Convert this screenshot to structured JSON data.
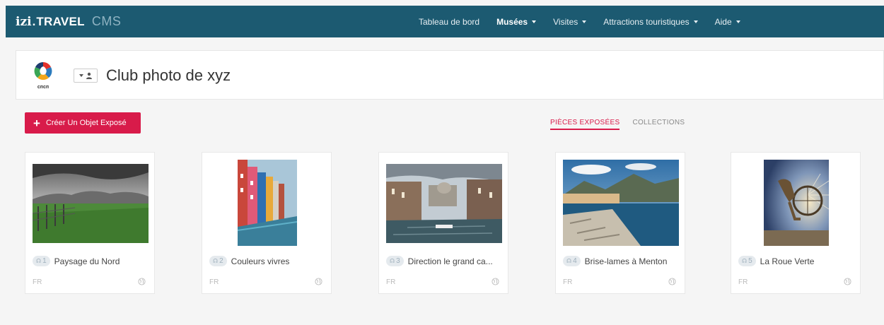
{
  "brand": {
    "izi": "izi",
    "dot": ".",
    "travel": "TRAVEL",
    "cms": "CMS"
  },
  "nav": [
    {
      "label": "Tableau de bord",
      "dropdown": false,
      "active": false
    },
    {
      "label": "Musées",
      "dropdown": true,
      "active": true
    },
    {
      "label": "Visites",
      "dropdown": true,
      "active": false
    },
    {
      "label": "Attractions touristiques",
      "dropdown": true,
      "active": false
    },
    {
      "label": "Aide",
      "dropdown": true,
      "active": false
    }
  ],
  "header": {
    "logo_text": "спсп",
    "title": "Club photo de xyz"
  },
  "toolbar": {
    "create_label": "Créer Un Objet Exposé"
  },
  "tabs": [
    {
      "label": "PIÈCES EXPOSÉES",
      "active": true
    },
    {
      "label": "COLLECTIONS",
      "active": false
    }
  ],
  "cards": [
    {
      "number": "1",
      "title": "Paysage du Nord",
      "lang": "FR",
      "image": "landscape-bw-field"
    },
    {
      "number": "2",
      "title": "Couleurs vivres",
      "lang": "FR",
      "image": "colorful-canal-houses"
    },
    {
      "number": "3",
      "title": "Direction le grand ca...",
      "lang": "FR",
      "image": "venice-grand-canal"
    },
    {
      "number": "4",
      "title": "Brise-lames à Menton",
      "lang": "FR",
      "image": "menton-breakwater"
    },
    {
      "number": "5",
      "title": "La Roue Verte",
      "lang": "FR",
      "image": "bronze-cyclist-statue"
    }
  ],
  "colors": {
    "topbar": "#1c5a71",
    "accent": "#d81b4a",
    "background": "#f5f5f5"
  }
}
